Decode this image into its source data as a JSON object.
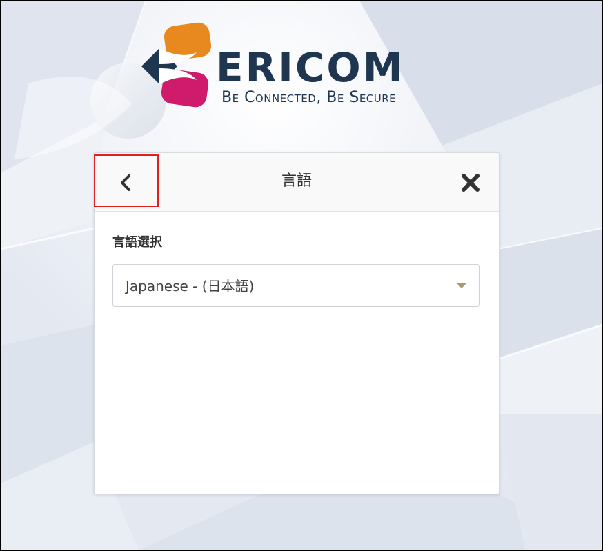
{
  "colors": {
    "brand_navy": "#1e3650",
    "brand_orange": "#e8891f",
    "brand_magenta": "#d01a6b",
    "highlight_red": "#e02020",
    "dropdown_arrow": "#a89b72"
  },
  "logo": {
    "wordmark": "ERICOM",
    "tagline": "Be Connected, Be Secure"
  },
  "dialog": {
    "title": "言語",
    "back_icon": "chevron-left-icon",
    "close_icon": "close-x-icon",
    "language_label": "言語選択",
    "language_select": {
      "selected": "Japanese - (日本語)",
      "arrow_icon": "caret-down-icon"
    }
  }
}
